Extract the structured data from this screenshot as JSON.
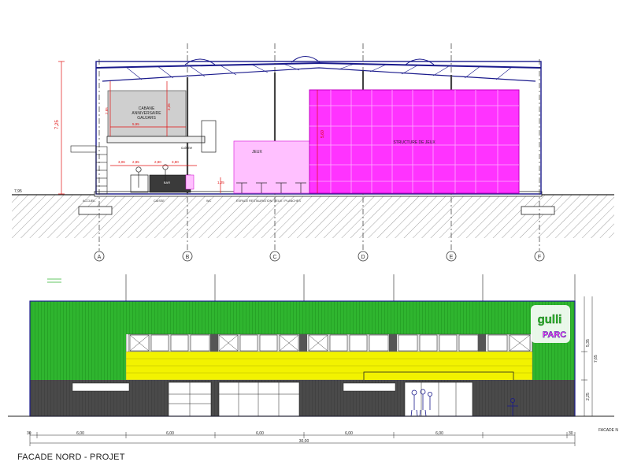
{
  "caption": "FACADE NORD - PROJET",
  "side_label": "FACADE N",
  "section": {
    "grid_axes": [
      "A",
      "B",
      "C",
      "D",
      "E",
      "F"
    ],
    "left_height": "7,25",
    "ground_level": "7,95",
    "floor_dims": [
      "1,25",
      "6,70",
      "5,70",
      "0,60",
      "0,80"
    ],
    "mid_dims": [
      "3,06",
      "2,85",
      "2,80",
      "3,80",
      "2,85",
      "2,35"
    ],
    "room_lines": [
      "CABANE",
      "ANNIVERSAIRE",
      "GAUJARS"
    ],
    "play_label": "JEUX",
    "play_structure_label": "STRUCTURE DE JEUX",
    "play_height": "5,60",
    "room_width": "5,95",
    "bar_label": "BAR",
    "upper_room_label": "cuisine",
    "zone_labels": [
      "ACCUEIL",
      "CAISSE",
      "WC",
      "ESPACE RESTAURATION / JEUX / PLANCHES"
    ]
  },
  "facade": {
    "bay_dims": [
      "6,00",
      "6,00",
      "6,00",
      "6,00",
      "6,00"
    ],
    "end_dims": [
      "30",
      "30"
    ],
    "overall": "30,00",
    "heights": [
      "5,35",
      "7,65",
      "2,25"
    ],
    "sign_line1": "gulli",
    "sign_line2": "PARC"
  },
  "colors": {
    "green": "#2fb52f",
    "green_dark": "#1d8f1d",
    "yellow": "#f2f200",
    "magenta": "#ff33ff",
    "pink": "#ffc0ff",
    "navy": "#1a1a8c",
    "gray_dark": "#4a4a4a",
    "red_dim": "#e01010"
  }
}
